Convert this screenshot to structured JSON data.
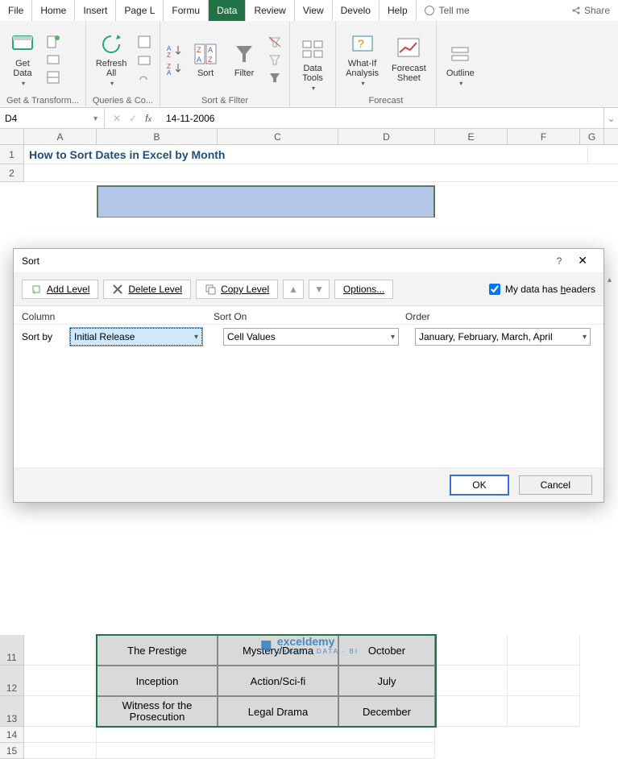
{
  "tabs": [
    "File",
    "Home",
    "Insert",
    "Page L",
    "Formu",
    "Data",
    "Review",
    "View",
    "Develo",
    "Help"
  ],
  "tellme": "Tell me",
  "share": "Share",
  "ribbon": {
    "g1": {
      "label": "Get & Transform...",
      "btn_get_data": "Get\nData",
      "btns": []
    },
    "g2": {
      "label": "Queries & Co...",
      "btn_refresh": "Refresh\nAll"
    },
    "g3": {
      "label": "Sort & Filter",
      "sort": "Sort",
      "filter": "Filter"
    },
    "g4": {
      "label": "",
      "data_tools": "Data\nTools"
    },
    "g5": {
      "label": "Forecast",
      "whatif": "What-If\nAnalysis",
      "forecast": "Forecast\nSheet"
    },
    "g6": {
      "label": "",
      "outline": "Outline"
    }
  },
  "namebox": "D4",
  "formula": "14-11-2006",
  "columns": [
    "A",
    "B",
    "C",
    "D",
    "E",
    "F",
    "G"
  ],
  "rows_top": [
    "1",
    "2"
  ],
  "title_cell": "How to Sort Dates in Excel by Month",
  "rows_bottom": [
    "11",
    "12",
    "13",
    "14",
    "15"
  ],
  "lower_data": [
    {
      "b": "The Prestige",
      "c": "Mystery/Drama",
      "d": "October"
    },
    {
      "b": "Inception",
      "c": "Action/Sci-fi",
      "d": "July"
    },
    {
      "b": "Witness for the Prosecution",
      "c": "Legal Drama",
      "d": "December"
    }
  ],
  "dialog": {
    "title": "Sort",
    "add": "Add Level",
    "delete": "Delete Level",
    "copy": "Copy Level",
    "options": "Options...",
    "headers": "My data has headers",
    "col": "Column",
    "sorton": "Sort On",
    "order": "Order",
    "sortby": "Sort by",
    "sel_column": "Initial Release",
    "sel_sorton": "Cell Values",
    "sel_order": "January, February, March, April",
    "ok": "OK",
    "cancel": "Cancel"
  },
  "watermark": {
    "brand": "exceldemy",
    "sub": "EXCEL · DATA · BI"
  }
}
